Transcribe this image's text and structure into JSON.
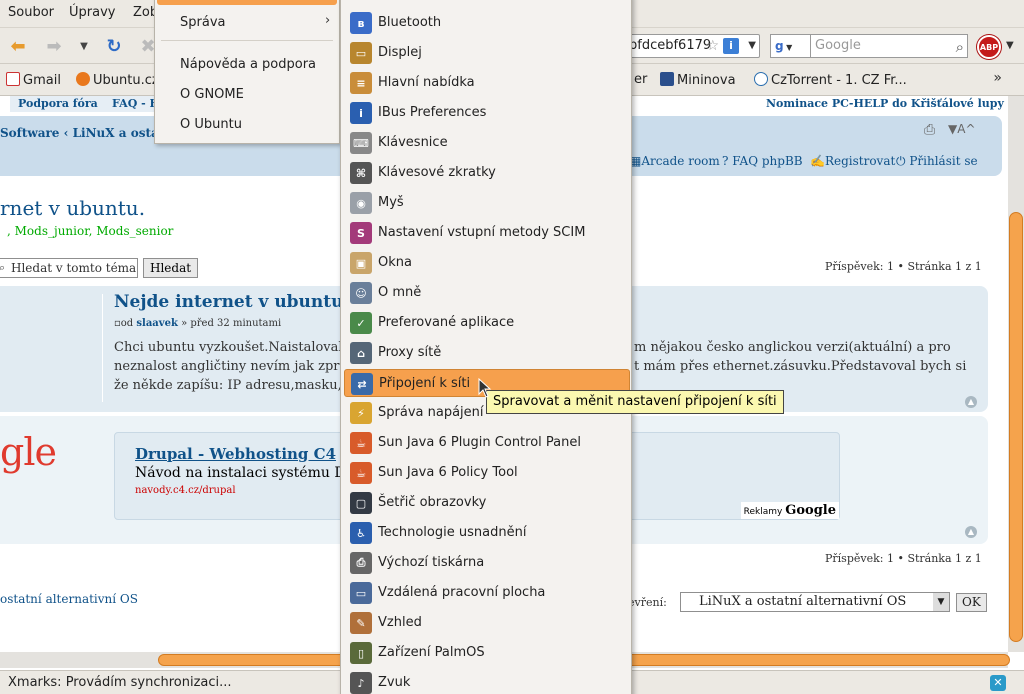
{
  "menubar": {
    "items": [
      {
        "label": "Soubor",
        "ul": "S"
      },
      {
        "label": "Úpravy",
        "ul": "Ú"
      },
      {
        "label": "Zob",
        "ul": "Z"
      }
    ]
  },
  "navbar": {
    "url_tail": "bfdcebf6179",
    "search_engine": "g",
    "search_placeholder": "Google",
    "abp": "ABP"
  },
  "bookmarks": {
    "items": [
      "Gmail",
      "Ubuntu.cz",
      "er",
      "Mininova",
      "CzTorrent - 1. CZ Fr..."
    ],
    "chevron": "»"
  },
  "forum": {
    "topnav": [
      "Podpora fóra",
      "FAQ - F"
    ],
    "nominace": "Nominace PC-HELP do Křišťálové lupy",
    "breadcrumb": "Software ‹ LiNuX a ostatní",
    "fontsize": "▼A^",
    "header_links": [
      "Arcade room",
      "FAQ phpBB",
      "Registrovat",
      "Přihlásit se"
    ],
    "topic_title": "rnet v ubuntu.",
    "moderators": ", Mods_junior, Mods_senior",
    "search_value": "Hledat v tomto téma",
    "search_button": "Hledat",
    "page_info": "Příspěvek: 1 • Stránka 1 z 1",
    "post": {
      "title": "Nejde internet v ubuntu",
      "meta_prefix": "od",
      "author": "slaavek",
      "time": "» před 32 minutami",
      "body_line1_left": "Chci ubuntu vyzkoušet.Naistaloval",
      "body_line1_right": "m nějakou česko anglickou verzi(aktuální) a pro",
      "body_line2_left": "neznalost angličtiny nevím jak zpro",
      "body_line2_right": "t mám přes ethernet.zásuvku.Představoval bych si",
      "body_line3": "že někde zapíšu: IP adresu,masku,"
    },
    "ad": {
      "logo": "gle",
      "title": "Drupal - Webhosting C4",
      "desc": "Návod na instalaci systému Dr",
      "url": "navody.c4.cz/drupal",
      "label_prefix": "Reklamy",
      "label_brand": "Google"
    },
    "bottom_forum": "ostatní alternativní OS",
    "jump_label": "evření:",
    "jump_value": "LiNuX a ostatní alternativní OS",
    "ok": "OK"
  },
  "status": {
    "text": "Xmarks: Provádím synchronizaci..."
  },
  "system_menu": {
    "items": [
      "Správa",
      "Nápověda a podpora",
      "O GNOME",
      "O Ubuntu"
    ],
    "arrow": "›"
  },
  "prefs_menu": {
    "items": [
      {
        "label": "Bluetooth",
        "icon": "bluetooth-icon",
        "color": "#3a6cc8",
        "glyph": "ʙ"
      },
      {
        "label": "Displej",
        "icon": "display-icon",
        "color": "#b8862e",
        "glyph": "▭"
      },
      {
        "label": "Hlavní nabídka",
        "icon": "main-menu-icon",
        "color": "#c98d3a",
        "glyph": "≡"
      },
      {
        "label": "IBus Preferences",
        "icon": "ibus-icon",
        "color": "#2a5fb0",
        "glyph": "i"
      },
      {
        "label": "Klávesnice",
        "icon": "keyboard-icon",
        "color": "#888888",
        "glyph": "⌨"
      },
      {
        "label": "Klávesové zkratky",
        "icon": "shortcuts-icon",
        "color": "#555555",
        "glyph": "⌘"
      },
      {
        "label": "Myš",
        "icon": "mouse-icon",
        "color": "#9aa0a8",
        "glyph": "◉"
      },
      {
        "label": "Nastavení vstupní metody SCIM",
        "icon": "scim-icon",
        "color": "#a33a7a",
        "glyph": "S"
      },
      {
        "label": "Okna",
        "icon": "windows-icon",
        "color": "#c9a56a",
        "glyph": "▣"
      },
      {
        "label": "O mně",
        "icon": "about-me-icon",
        "color": "#6a7f9a",
        "glyph": "☺"
      },
      {
        "label": "Preferované aplikace",
        "icon": "preferred-apps-icon",
        "color": "#4a8a4a",
        "glyph": "✓"
      },
      {
        "label": "Proxy sítě",
        "icon": "proxy-icon",
        "color": "#556677",
        "glyph": "⌂"
      },
      {
        "label": "Připojení k síti",
        "icon": "network-icon",
        "color": "#3a6aa8",
        "glyph": "⇄"
      },
      {
        "label": "Správa napájení",
        "icon": "power-icon",
        "color": "#d9a531",
        "glyph": "⚡"
      },
      {
        "label": "Sun Java 6 Plugin Control Panel",
        "icon": "java-plugin-icon",
        "color": "#d85b2a",
        "glyph": "☕"
      },
      {
        "label": "Sun Java 6 Policy Tool",
        "icon": "java-policy-icon",
        "color": "#d85b2a",
        "glyph": "☕"
      },
      {
        "label": "Šetřič obrazovky",
        "icon": "screensaver-icon",
        "color": "#333a44",
        "glyph": "▢"
      },
      {
        "label": "Technologie usnadnění",
        "icon": "accessibility-icon",
        "color": "#2b5fae",
        "glyph": "♿"
      },
      {
        "label": "Výchozí tiskárna",
        "icon": "printer-icon",
        "color": "#666666",
        "glyph": "⎙"
      },
      {
        "label": "Vzdálená pracovní plocha",
        "icon": "remote-desktop-icon",
        "color": "#4a6a9a",
        "glyph": "▭"
      },
      {
        "label": "Vzhled",
        "icon": "appearance-icon",
        "color": "#b0703a",
        "glyph": "✎"
      },
      {
        "label": "Zařízení PalmOS",
        "icon": "palmos-icon",
        "color": "#5a6a3a",
        "glyph": "▯"
      },
      {
        "label": "Zvuk",
        "icon": "sound-icon",
        "color": "#555555",
        "glyph": "♪"
      }
    ],
    "selected_index": 12
  },
  "tooltip": "Spravovat a měnit nastavení připojení k síti"
}
